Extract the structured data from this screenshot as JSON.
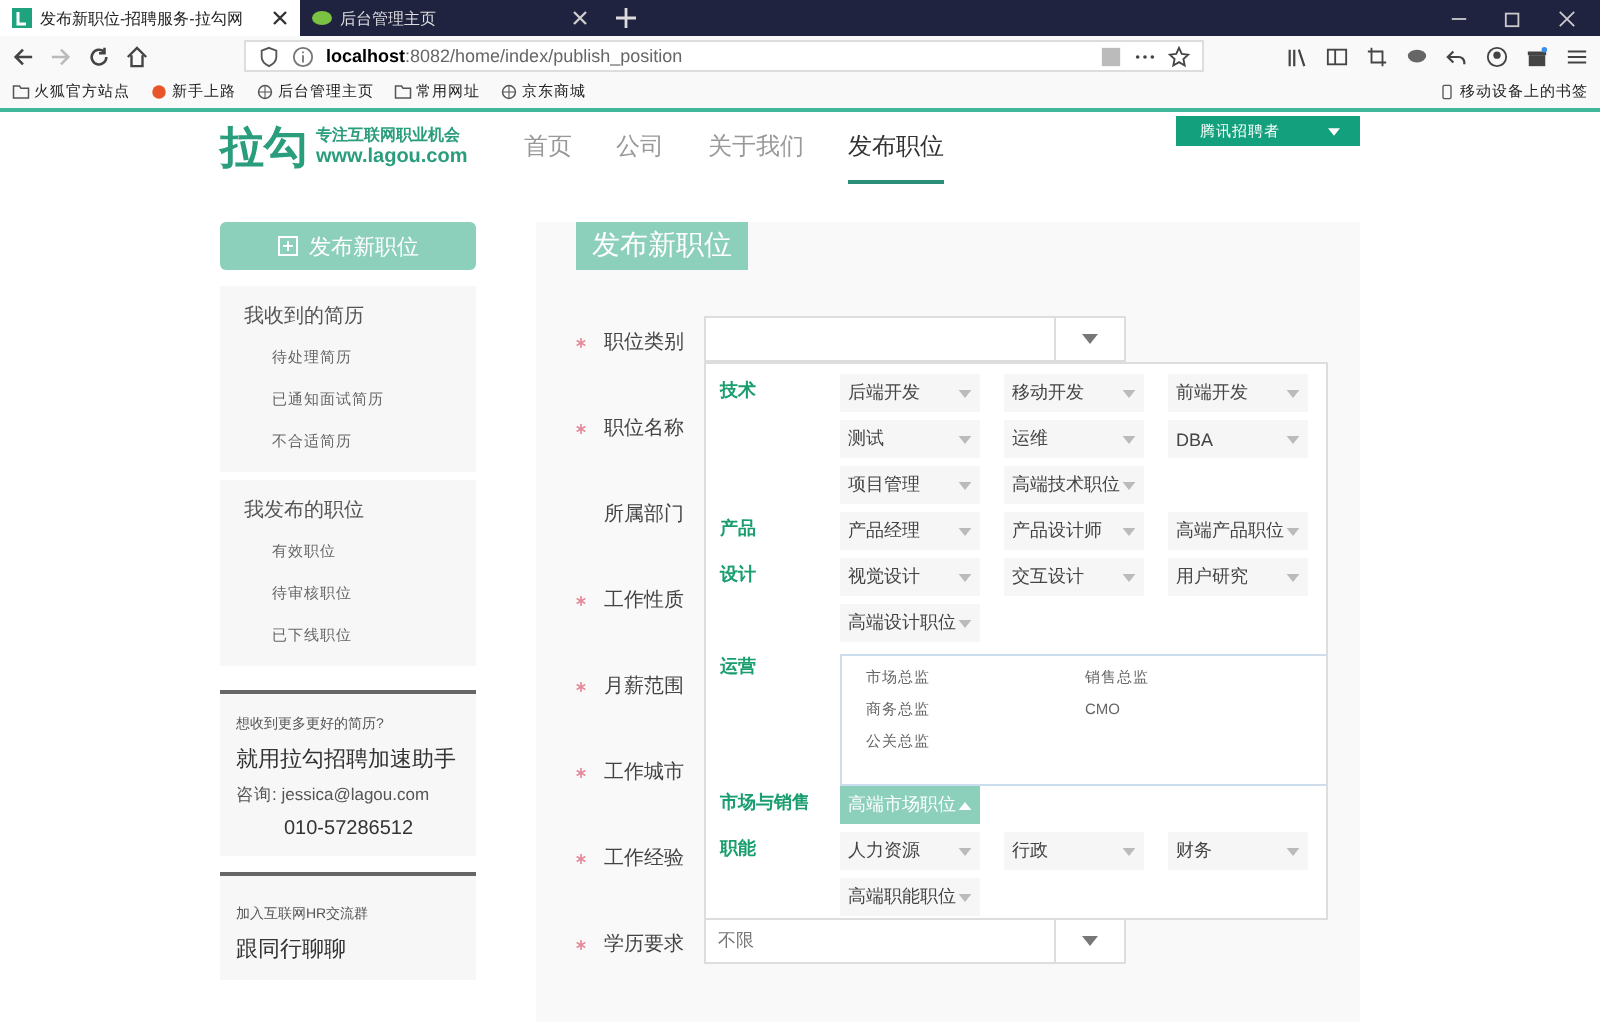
{
  "browser": {
    "tabs": [
      {
        "title": "发布新职位-招聘服务-拉勾网",
        "selected": true
      },
      {
        "title": "后台管理主页",
        "selected": false
      }
    ],
    "address": {
      "host": "localhost",
      "path": ":8082/home/index/publish_position"
    },
    "bookmarks": [
      {
        "label": "火狐官方站点",
        "kind": "folder"
      },
      {
        "label": "新手上路",
        "kind": "site"
      },
      {
        "label": "后台管理主页",
        "kind": "globe"
      },
      {
        "label": "常用网址",
        "kind": "folder"
      },
      {
        "label": "京东商城",
        "kind": "globe"
      }
    ],
    "mobile_bookmarks": "移动设备上的书签"
  },
  "header": {
    "logo": "拉勾",
    "slogan": "专注互联网职业机会",
    "domain": "www.lagou.com",
    "nav": [
      {
        "label": "首页",
        "selected": false
      },
      {
        "label": "公司",
        "selected": false
      },
      {
        "label": "关于我们",
        "selected": false
      },
      {
        "label": "发布职位",
        "selected": true
      }
    ],
    "user": "腾讯招聘者"
  },
  "sidebar": {
    "publish_button": "发布新职位",
    "sections": [
      {
        "title": "我收到的简历",
        "items": [
          "待处理简历",
          "已通知面试简历",
          "不合适简历"
        ]
      },
      {
        "title": "我发布的职位",
        "items": [
          "有效职位",
          "待审核职位",
          "已下线职位"
        ]
      }
    ],
    "promo": {
      "question": "想收到更多更好的简历?",
      "headline": "就用拉勾招聘加速助手",
      "contact": "咨询: jessica@lagou.com",
      "phone": "010-57286512"
    },
    "group": {
      "intro": "加入互联网HR交流群",
      "headline": "跟同行聊聊"
    }
  },
  "form": {
    "title": "发布新职位",
    "fields": [
      {
        "label": "职位类别",
        "required": true,
        "kind": "select"
      },
      {
        "label": "职位名称",
        "required": true
      },
      {
        "label": "所属部门",
        "required": false
      },
      {
        "label": "工作性质",
        "required": true
      },
      {
        "label": "月薪范围",
        "required": true
      },
      {
        "label": "工作城市",
        "required": true
      },
      {
        "label": "工作经验",
        "required": true
      },
      {
        "label": "学历要求",
        "required": true,
        "kind": "select",
        "value": "不限"
      }
    ],
    "category_menu": {
      "groups": [
        {
          "label": "技术",
          "items": [
            {
              "label": "后端开发",
              "expanded": false
            },
            {
              "label": "移动开发",
              "expanded": false
            },
            {
              "label": "前端开发",
              "expanded": false
            },
            {
              "label": "测试",
              "expanded": false
            },
            {
              "label": "运维",
              "expanded": false
            },
            {
              "label": "DBA",
              "expanded": false
            },
            {
              "label": "项目管理",
              "expanded": false
            },
            {
              "label": "高端技术职位",
              "expanded": false
            }
          ]
        },
        {
          "label": "产品",
          "items": [
            {
              "label": "产品经理",
              "expanded": false
            },
            {
              "label": "产品设计师",
              "expanded": false
            },
            {
              "label": "高端产品职位",
              "expanded": false
            }
          ]
        },
        {
          "label": "设计",
          "items": [
            {
              "label": "视觉设计",
              "expanded": false
            },
            {
              "label": "交互设计",
              "expanded": false
            },
            {
              "label": "用户研究",
              "expanded": false
            },
            {
              "label": "高端设计职位",
              "expanded": false
            }
          ]
        },
        {
          "label": "运营"
        },
        {
          "label": "市场与销售",
          "items": [
            {
              "label": "高端市场职位",
              "expanded": true,
              "options": [
                "市场总监",
                "销售总监",
                "商务总监",
                "CMO",
                "公关总监"
              ]
            }
          ]
        },
        {
          "label": "职能",
          "items": [
            {
              "label": "人力资源",
              "expanded": false
            },
            {
              "label": "行政",
              "expanded": false
            },
            {
              "label": "财务",
              "expanded": false
            },
            {
              "label": "高端职能职位",
              "expanded": false
            }
          ]
        }
      ]
    }
  }
}
